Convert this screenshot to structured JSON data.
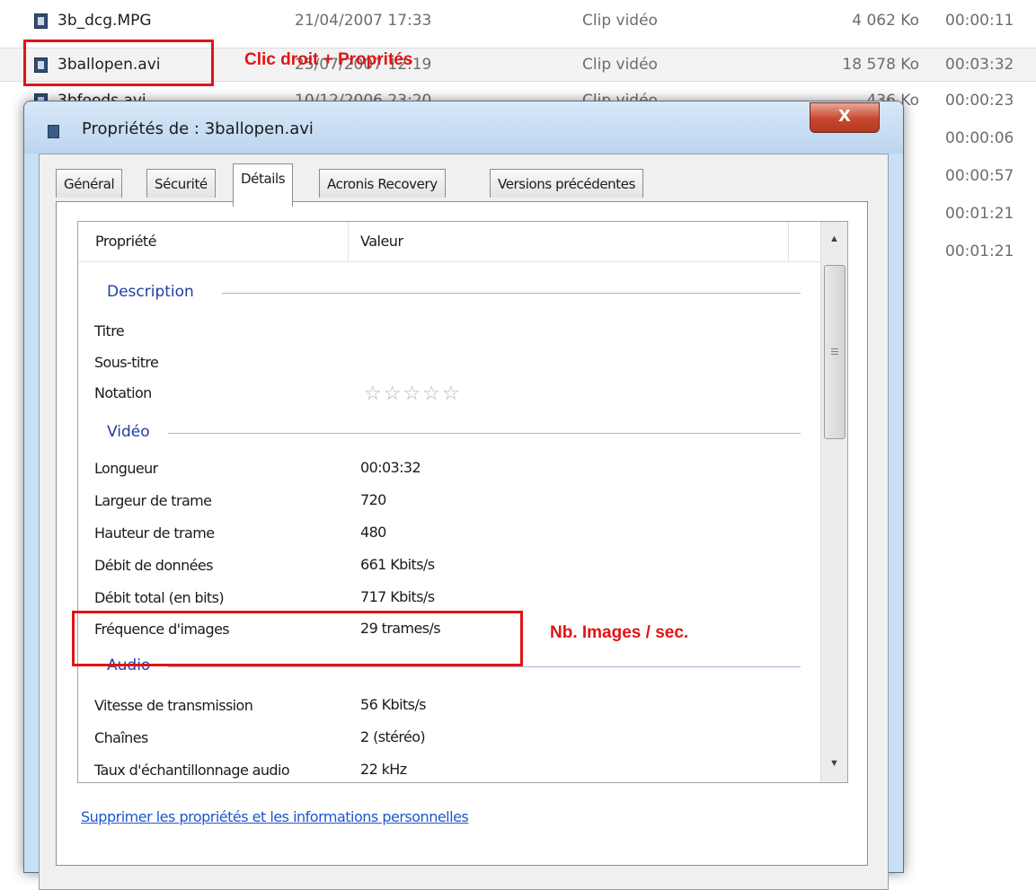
{
  "explorer": {
    "rows": [
      {
        "name": "3b_dcg.MPG",
        "date": "21/04/2007 17:33",
        "type": "Clip vidéo",
        "size": "4 062 Ko",
        "duration": "00:00:11"
      },
      {
        "name": "3ballopen.avi",
        "date": "25/07/2007 12:19",
        "type": "Clip vidéo",
        "size": "18 578 Ko",
        "duration": "00:03:32"
      },
      {
        "name": "3bfoods.avi",
        "date": "10/12/2006 23:20",
        "type": "Clip vidéo",
        "size": "436 Ko",
        "duration": "00:00:23"
      }
    ],
    "more_durations": [
      "00:00:06",
      "00:00:57",
      "00:01:21",
      "00:01:21"
    ],
    "annotation_right_click": "Clic droit + Proprités"
  },
  "dialog": {
    "title": "Propriétés de : 3ballopen.avi",
    "close_label": "X",
    "tabs": [
      {
        "label": "Général",
        "active": false
      },
      {
        "label": "Sécurité",
        "active": false
      },
      {
        "label": "Détails",
        "active": true
      },
      {
        "label": "Acronis Recovery",
        "active": false
      },
      {
        "label": "Versions précédentes",
        "active": false
      }
    ],
    "columns": {
      "property": "Propriété",
      "value": "Valeur"
    },
    "groups": {
      "description": "Description",
      "video": "Vidéo",
      "audio": "Audio"
    },
    "properties": {
      "titre": {
        "label": "Titre",
        "value": ""
      },
      "sous_titre": {
        "label": "Sous-titre",
        "value": ""
      },
      "notation": {
        "label": "Notation",
        "stars": 0,
        "max_stars": 5
      },
      "longueur": {
        "label": "Longueur",
        "value": "00:03:32"
      },
      "largeur": {
        "label": "Largeur de trame",
        "value": "720"
      },
      "hauteur": {
        "label": "Hauteur de trame",
        "value": "480"
      },
      "debit_donnees": {
        "label": "Débit de données",
        "value": "661 Kbits/s"
      },
      "debit_total": {
        "label": "Débit total (en bits)",
        "value": "717 Kbits/s"
      },
      "frequence": {
        "label": "Fréquence d'images",
        "value": "29 trames/s"
      },
      "vitesse": {
        "label": "Vitesse de transmission",
        "value": "56 Kbits/s"
      },
      "chaines": {
        "label": "Chaînes",
        "value": "2 (stéréo)"
      },
      "echantillonnage": {
        "label": "Taux d'échantillonnage audio",
        "value": "22 kHz"
      }
    },
    "annotation_fps": "Nb. Images / sec.",
    "remove_link": "Supprimer les propriétés et les informations personnelles"
  },
  "colors": {
    "annotation_red": "#e31313",
    "group_blue": "#1e3f9e",
    "link_blue": "#1d57c8",
    "close_red": "#c8462e"
  },
  "icons": [
    "video-file-icon",
    "star-outline-icon",
    "scroll-up-arrow-icon",
    "scroll-down-arrow-icon",
    "close-icon"
  ]
}
